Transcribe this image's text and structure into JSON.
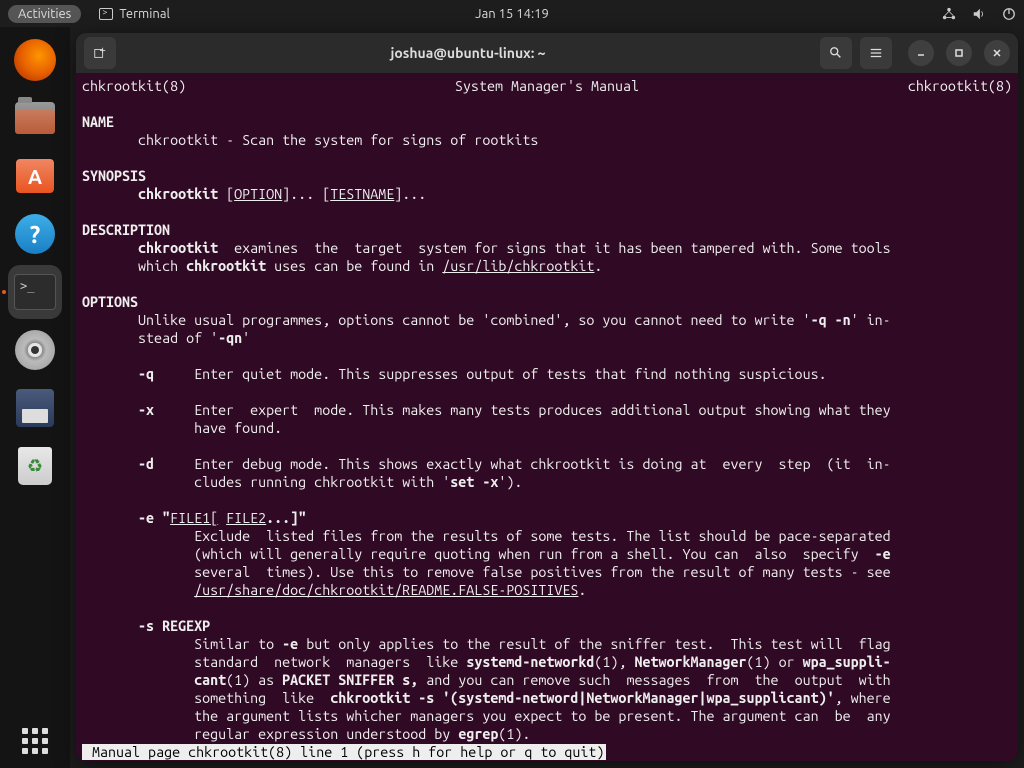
{
  "topbar": {
    "activities": "Activities",
    "app_name": "Terminal",
    "clock": "Jan 15  14:19"
  },
  "window": {
    "title": "joshua@ubuntu-linux: ~"
  },
  "man": {
    "header_left": "chkrootkit(8)",
    "header_center": "System Manager's Manual",
    "header_right": "chkrootkit(8)",
    "name_hdr": "NAME",
    "name_line": "chkrootkit - Scan the system for signs of rootkits",
    "syn_hdr": "SYNOPSIS",
    "syn_cmd": "chkrootkit",
    "syn_opt": "OPTION",
    "syn_test": "TESTNAME",
    "desc_hdr": "DESCRIPTION",
    "desc_l1a": "chkrootkit",
    "desc_l1b": "  examines  the  target  system for signs that it has been tampered with. Some tools",
    "desc_l2a": "which ",
    "desc_l2b": "chkrootkit",
    "desc_l2c": " uses can be found in ",
    "desc_l2d": "/usr/lib/chkrootkit",
    "opts_hdr": "OPTIONS",
    "opts_intro1": "Unlike usual programmes, options cannot be 'combined', so you cannot need to write '",
    "opts_intro_q": "-q -n",
    "opts_intro2": "' in-",
    "opts_intro3": "stead of '",
    "opts_intro_qn": "-qn",
    "opts_intro4": "'",
    "q_flag": "-q",
    "q_desc": "Enter quiet mode. This suppresses output of tests that find nothing suspicious.",
    "x_flag": "-x",
    "x_desc1": "Enter  expert  mode. This makes many tests produces additional output showing what they",
    "x_desc2": "have found.",
    "d_flag": "-d",
    "d_desc1": "Enter debug mode. This shows exactly what chkrootkit is doing at  every  step  (it  in-",
    "d_desc2": "cludes running chkrootkit with '",
    "d_setx": "set -x",
    "d_desc3": "').",
    "e_flag": "-e \"",
    "e_file1": "FILE1[",
    "e_file2": "FILE2",
    "e_end": "...]\"",
    "e_desc1": "Exclude  listed files from the results of some tests. The list should be pace-separated",
    "e_desc2": "(which will generally require quoting when run from a shell. You can  also  specify  ",
    "e_desc2b": "-e",
    "e_desc3": "several  times). Use this to remove false positives from the result of many tests - see",
    "e_path": "/usr/share/doc/chkrootkit/README.FALSE-POSITIVES",
    "s_flag": "-s REGEXP",
    "s_desc1a": "Similar to ",
    "s_desc1b": "-e",
    "s_desc1c": " but only applies to the result of the sniffer test.  This test will  flag",
    "s_desc2a": "standard  network  managers  like ",
    "s_desc2b": "systemd-networkd",
    "s_desc2c": "(1), ",
    "s_desc2d": "NetworkManager",
    "s_desc2e": "(1) or ",
    "s_desc2f": "wpa_suppli-",
    "s_desc3a": "cant",
    "s_desc3b": "(1) as ",
    "s_desc3c": "PACKET SNIFFER s,",
    "s_desc3d": " and you can remove such  messages  from  the  output  with",
    "s_desc4a": "something  like  ",
    "s_desc4b": "chkrootkit -s '(systemd-netword|NetworkManager|wpa_supplicant)'",
    "s_desc4c": ", where",
    "s_desc5": "the argument lists whicher managers you expect to be present. The argument can  be  any",
    "s_desc6a": "regular expression understood by ",
    "s_desc6b": "egrep",
    "s_desc6c": "(1).",
    "status": " Manual page chkrootkit(8) line 1 (press h for help or q to quit)"
  }
}
